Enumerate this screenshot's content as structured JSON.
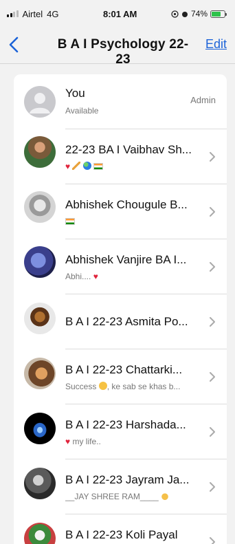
{
  "status_bar": {
    "carrier": "Airtel",
    "network": "4G",
    "time": "8:01 AM",
    "battery_percent": "74%",
    "battery_level": 0.74
  },
  "nav": {
    "title": "B A I Psychology 22-23",
    "edit_label": "Edit"
  },
  "participants": [
    {
      "name": "You",
      "subtitle": "Available",
      "badge": "Admin"
    },
    {
      "name": "22-23 BA I Vaibhav Sh...",
      "subtitle_icons": [
        "heart",
        "brush",
        "globe",
        "india-flag"
      ]
    },
    {
      "name": "Abhishek Chougule B...",
      "subtitle_icons": [
        "india-flag"
      ]
    },
    {
      "name": "Abhishek Vanjire BA I...",
      "subtitle": "Abhi....",
      "subtitle_icons": [
        "heart"
      ]
    },
    {
      "name": "B A I 22-23 Asmita Po..."
    },
    {
      "name": "B A I 22-23 Chattarki...",
      "subtitle_prefix": "Success",
      "subtitle": ", ke sab se khas b..."
    },
    {
      "name": "B A I 22-23 Harshada...",
      "subtitle": "my life.."
    },
    {
      "name": "B A I 22-23 Jayram Ja...",
      "subtitle": "__JAY  SHREE  RAM____"
    },
    {
      "name": "B A I 22-23 Koli Payal"
    }
  ]
}
